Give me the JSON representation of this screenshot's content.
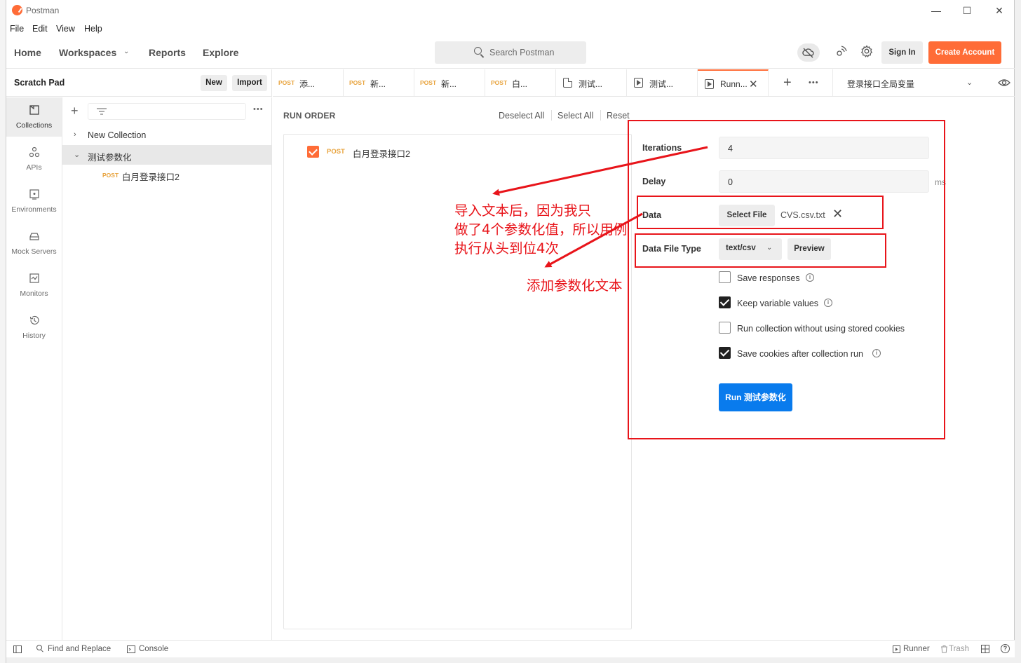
{
  "window": {
    "title": "Postman"
  },
  "menu": [
    "File",
    "Edit",
    "View",
    "Help"
  ],
  "nav": {
    "home": "Home",
    "workspaces": "Workspaces",
    "reports": "Reports",
    "explore": "Explore",
    "search_placeholder": "Search Postman",
    "sign_in": "Sign In",
    "create_account": "Create Account"
  },
  "sidebar": {
    "workspace_name": "Scratch Pad",
    "new_label": "New",
    "import_label": "Import",
    "rail": [
      {
        "label": "Collections",
        "icon": "collections-icon"
      },
      {
        "label": "APIs",
        "icon": "apis-icon"
      },
      {
        "label": "Environments",
        "icon": "environments-icon"
      },
      {
        "label": "Mock Servers",
        "icon": "mock-servers-icon"
      },
      {
        "label": "Monitors",
        "icon": "monitors-icon"
      },
      {
        "label": "History",
        "icon": "history-icon"
      }
    ],
    "tree": [
      {
        "label": "New Collection",
        "expanded": false
      },
      {
        "label": "测试参数化",
        "expanded": true,
        "selected": true
      }
    ],
    "request": {
      "method": "POST",
      "name": "白月登录接口2"
    }
  },
  "tabs": [
    {
      "method": "POST",
      "title": "添..."
    },
    {
      "method": "POST",
      "title": "新..."
    },
    {
      "method": "POST",
      "title": "新..."
    },
    {
      "method": "POST",
      "title": "白..."
    },
    {
      "icon": "document-icon",
      "title": "测试..."
    },
    {
      "icon": "runner-icon",
      "title": "测试..."
    },
    {
      "icon": "runner-icon",
      "title": "Runn...",
      "active": true
    }
  ],
  "environment": {
    "name": "登录接口全局变量"
  },
  "runner": {
    "run_order_label": "RUN ORDER",
    "deselect_all": "Deselect All",
    "select_all": "Select All",
    "reset": "Reset",
    "requests": [
      {
        "checked": true,
        "method": "POST",
        "name": "白月登录接口2"
      }
    ],
    "iterations_label": "Iterations",
    "iterations_value": "4",
    "delay_label": "Delay",
    "delay_value": "0",
    "delay_unit": "ms",
    "data_label": "Data",
    "select_file": "Select File",
    "file_name": "CVS.csv.txt",
    "data_file_type_label": "Data File Type",
    "data_file_type_value": "text/csv",
    "preview": "Preview",
    "options": [
      {
        "label": "Save responses",
        "checked": false,
        "info": true
      },
      {
        "label": "Keep variable values",
        "checked": true,
        "info": true
      },
      {
        "label": "Run collection without using stored cookies",
        "checked": false,
        "info": false
      },
      {
        "label": "Save cookies after collection run",
        "checked": true,
        "info": true
      }
    ],
    "run_button": "Run 测试参数化"
  },
  "statusbar": {
    "find_replace": "Find and Replace",
    "console": "Console",
    "runner": "Runner",
    "trash": "Trash"
  },
  "annotations": {
    "note_line1": "导入文本后，因为我只",
    "note_line2": "做了4个参数化值，所以用例",
    "note_line3": "执行从头到位4次",
    "note_add": "添加参数化文本",
    "color": "#e8141a"
  },
  "colors": {
    "accent": "#ff6c37",
    "run_button": "#097bed",
    "annotation": "#e8141a"
  }
}
